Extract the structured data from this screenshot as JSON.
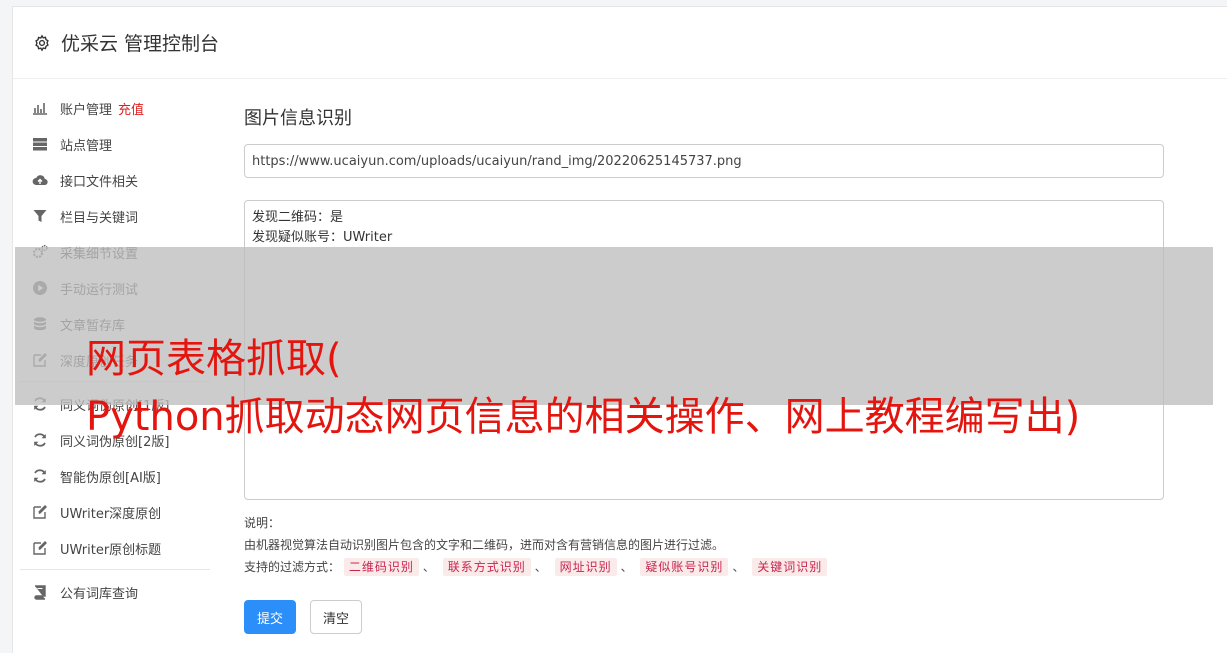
{
  "header": {
    "title": "优采云 管理控制台"
  },
  "sidebar": {
    "group1": [
      {
        "label": "账户管理",
        "tag": "充值",
        "icon": "bar-chart-icon"
      },
      {
        "label": "站点管理",
        "icon": "server-icon"
      },
      {
        "label": "接口文件相关",
        "icon": "cloud-upload-icon"
      },
      {
        "label": "栏目与关键词",
        "icon": "filter-icon"
      },
      {
        "label": "采集细节设置",
        "icon": "cogs-icon"
      },
      {
        "label": "手动运行测试",
        "icon": "play-circle-icon"
      },
      {
        "label": "文章暂存库",
        "icon": "database-icon"
      },
      {
        "label": "深度原创任务",
        "icon": "edit-icon"
      }
    ],
    "group2": [
      {
        "label": "同义词伪原创[1版]",
        "icon": "refresh-icon"
      },
      {
        "label": "同义词伪原创[2版]",
        "icon": "refresh-icon"
      },
      {
        "label": "智能伪原创[AI版]",
        "icon": "refresh-icon"
      },
      {
        "label": "UWriter深度原创",
        "icon": "edit-icon"
      },
      {
        "label": "UWriter原创标题",
        "icon": "edit-icon"
      }
    ],
    "group3": [
      {
        "label": "公有词库查询",
        "icon": "book-icon"
      }
    ]
  },
  "main": {
    "title": "图片信息识别",
    "url_value": "https://www.ucaiyun.com/uploads/ucaiyun/rand_img/20220625145737.png",
    "result_lines": [
      "发现二维码：是",
      "发现疑似账号：UWriter"
    ],
    "note_label": "说明：",
    "note_desc": "由机器视觉算法自动识别图片包含的文字和二维码，进而对含有营销信息的图片进行过滤。",
    "filters_label": "支持的过滤方式：",
    "filters": [
      "二维码识别",
      "联系方式识别",
      "网址识别",
      "疑似账号识别",
      "关键词识别"
    ],
    "filter_separator": "、",
    "submit_label": "提交",
    "clear_label": "清空"
  },
  "overlay": {
    "line1": "网页表格抓取(",
    "line2": "Python抓取动态网页信息的相关操作、网上教程编写出)"
  },
  "colors": {
    "primary": "#2c8ef8",
    "danger": "#e02020",
    "overlay_text": "#e4140e",
    "filter_text": "#c7254e"
  }
}
